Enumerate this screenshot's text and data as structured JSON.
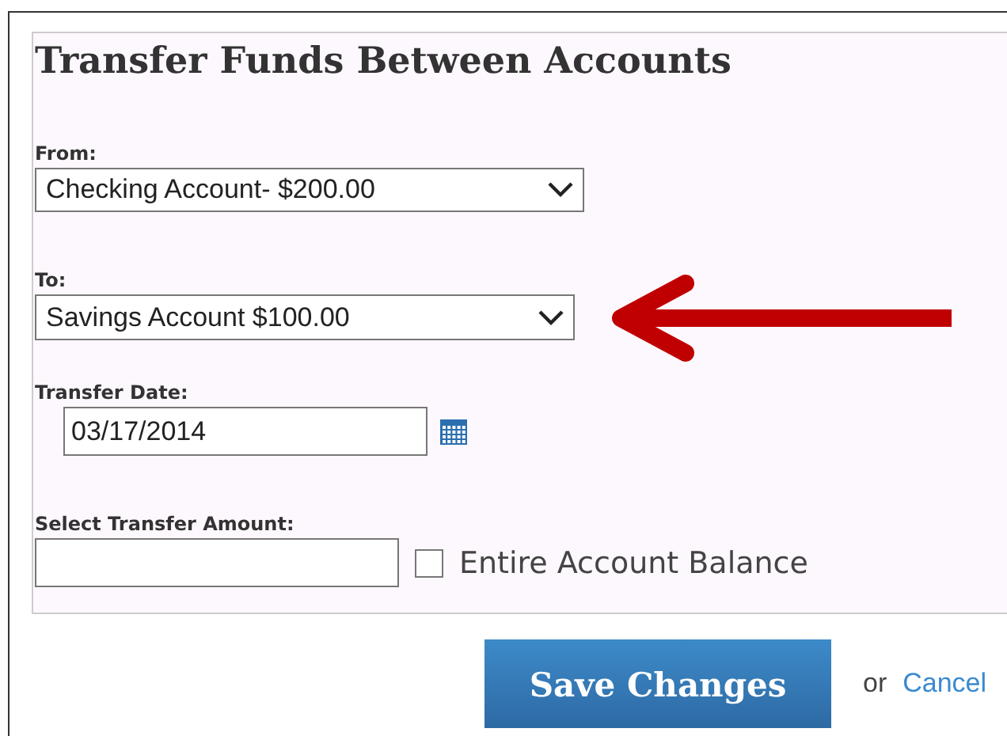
{
  "title": "Transfer Funds Between Accounts",
  "from": {
    "label": "From:",
    "value": "Checking Account- $200.00"
  },
  "to": {
    "label": "To:",
    "value": "Savings Account $100.00"
  },
  "transfer_date": {
    "label": "Transfer Date:",
    "value": "03/17/2014"
  },
  "amount": {
    "label": "Select Transfer Amount:",
    "entire_balance": {
      "label": "Entire Account Balance",
      "checked": false
    }
  },
  "actions": {
    "save": "Save Changes",
    "separator": "or",
    "cancel": "Cancel"
  }
}
